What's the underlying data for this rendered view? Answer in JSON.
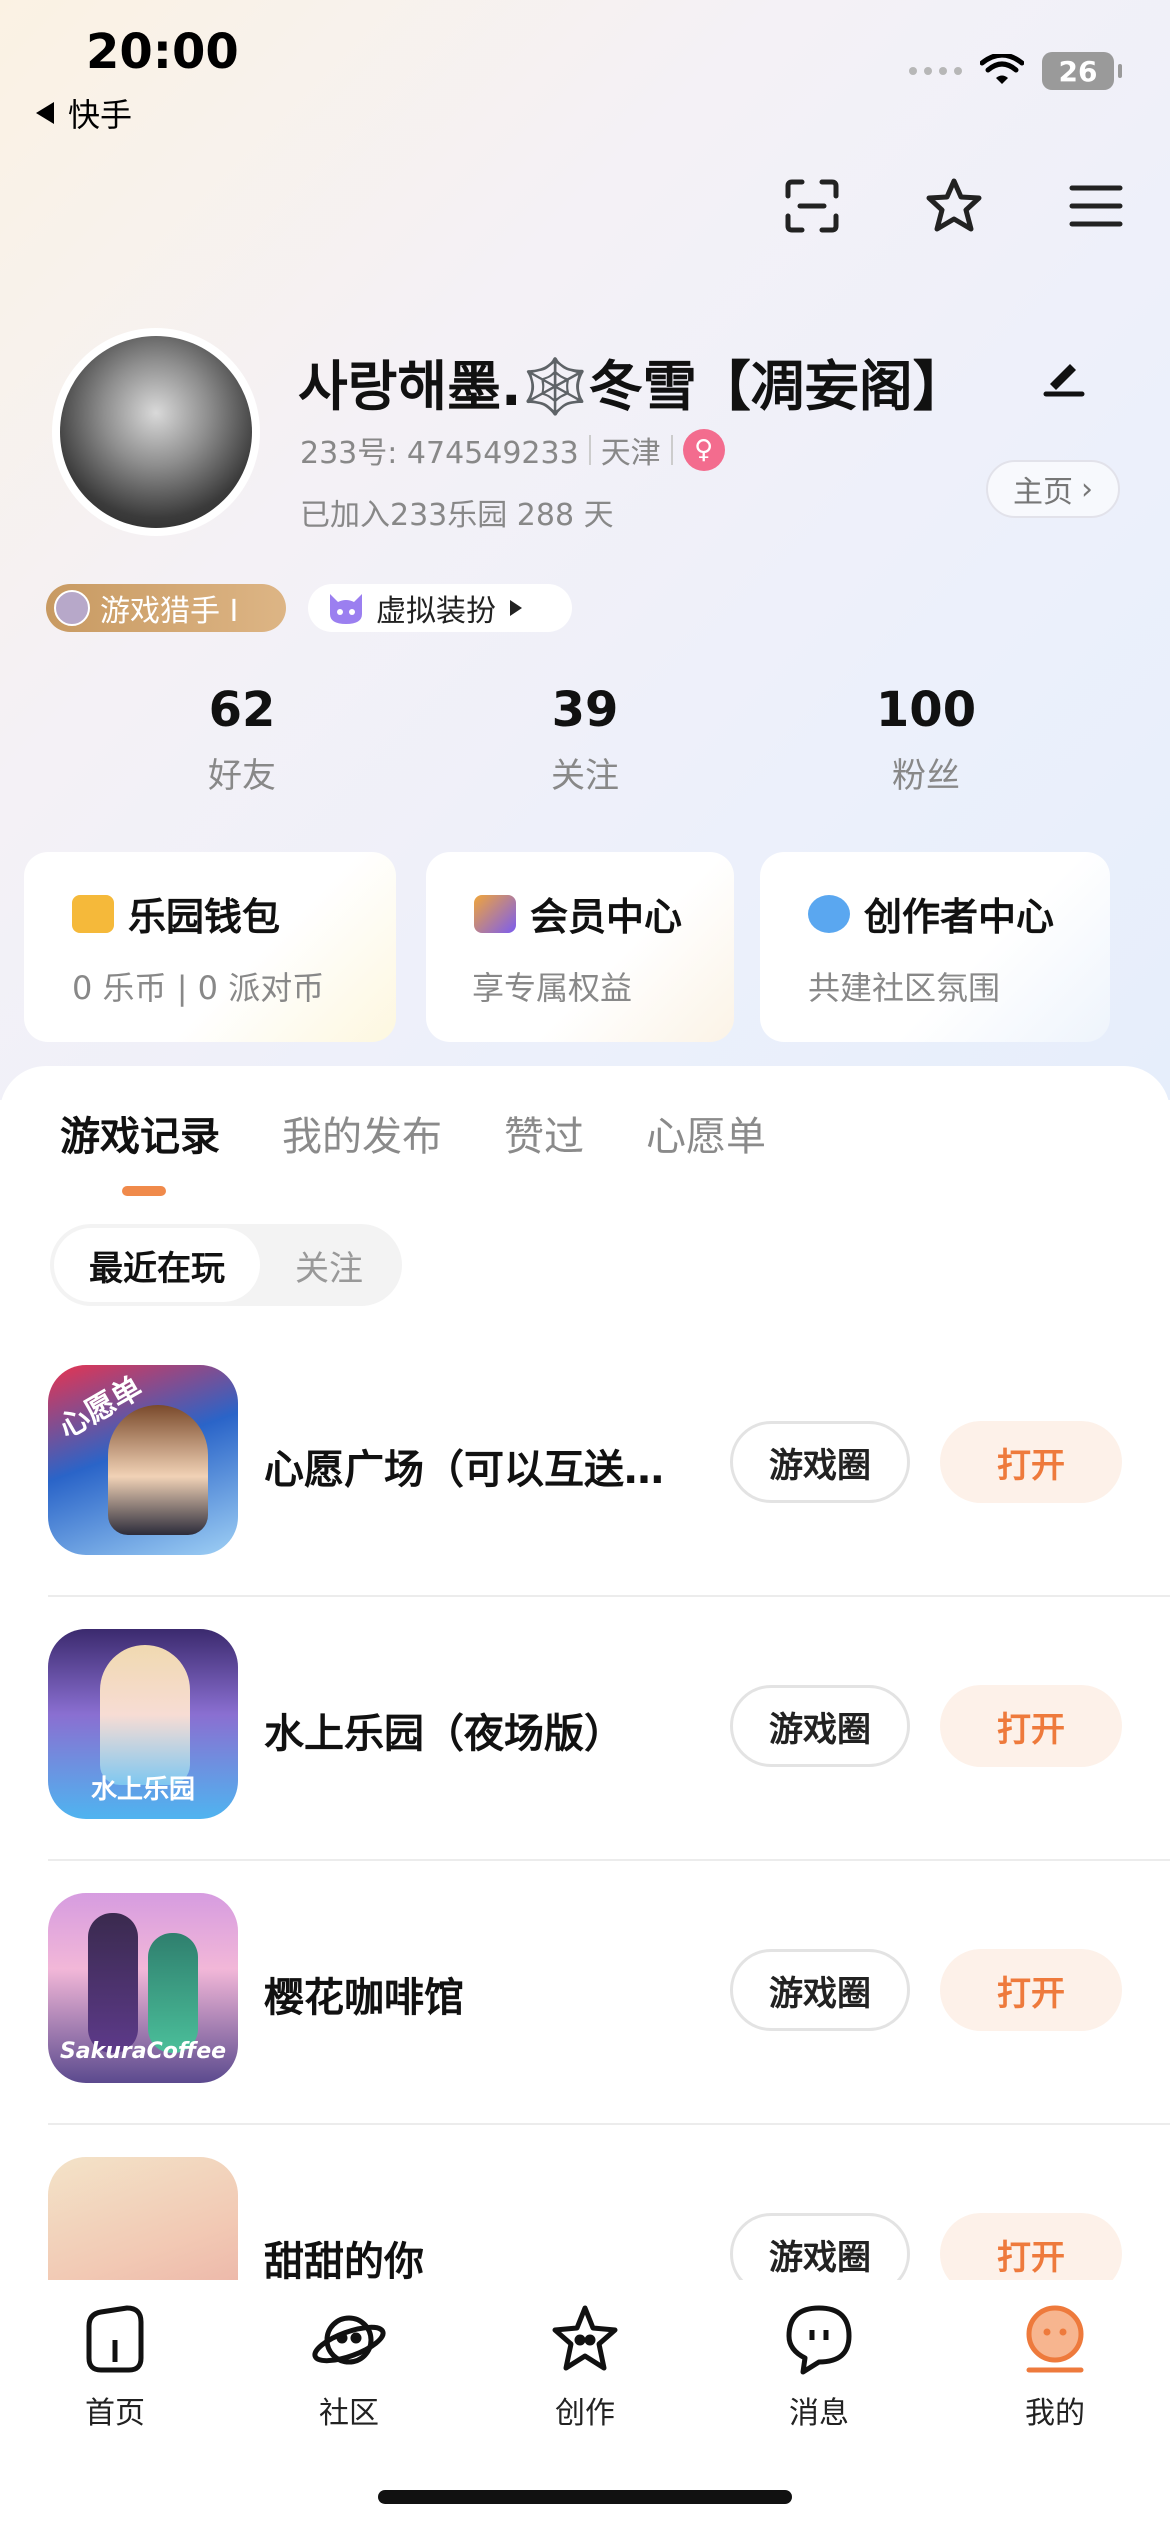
{
  "status_bar": {
    "time": "20:00",
    "back_app": "快手",
    "battery": "26"
  },
  "profile": {
    "nickname": "사랑해墨.🕸️冬雪【凋妄阁】",
    "id_line": "233号: 474549233",
    "location": "天津",
    "joined": "已加入233乐园 288 天",
    "home_label": "主页",
    "badge_hunter": "游戏猎手 Ⅰ",
    "badge_dress": "虚拟装扮"
  },
  "stats": [
    {
      "num": "62",
      "label": "好友"
    },
    {
      "num": "39",
      "label": "关注"
    },
    {
      "num": "100",
      "label": "粉丝"
    }
  ],
  "cards": [
    {
      "title": "乐园钱包",
      "sub": "0 乐币 | 0 派对币",
      "icon": "wallet-icon",
      "color": "#f5b93a"
    },
    {
      "title": "会员中心",
      "sub": "享专属权益",
      "icon": "crown-icon",
      "color": "#7b5cf0"
    },
    {
      "title": "创作者中心",
      "sub": "共建社区氛围",
      "icon": "planet-icon",
      "color": "#5aa7f0"
    }
  ],
  "tabs": [
    "游戏记录",
    "我的发布",
    "赞过",
    "心愿单"
  ],
  "segment": [
    "最近在玩",
    "关注"
  ],
  "games": [
    {
      "name": "心愿广场（可以互送礼物哦）",
      "circle": "游戏圈",
      "open": "打开",
      "icon_text": "心愿单"
    },
    {
      "name": "水上乐园（夜场版）",
      "circle": "游戏圈",
      "open": "打开",
      "icon_text": "水上乐园"
    },
    {
      "name": "樱花咖啡馆",
      "circle": "游戏圈",
      "open": "打开",
      "icon_text": "SakuraCoffee"
    },
    {
      "name": "甜甜的你",
      "circle": "游戏圈",
      "open": "打开",
      "icon_text": ""
    }
  ],
  "nav": [
    {
      "label": "首页",
      "icon": "home-icon"
    },
    {
      "label": "社区",
      "icon": "community-icon"
    },
    {
      "label": "创作",
      "icon": "create-icon"
    },
    {
      "label": "消息",
      "icon": "message-icon"
    },
    {
      "label": "我的",
      "icon": "profile-icon",
      "active": true
    }
  ],
  "colors": {
    "accent": "#ee7a3c",
    "active_nav": "#ee7a3c"
  }
}
